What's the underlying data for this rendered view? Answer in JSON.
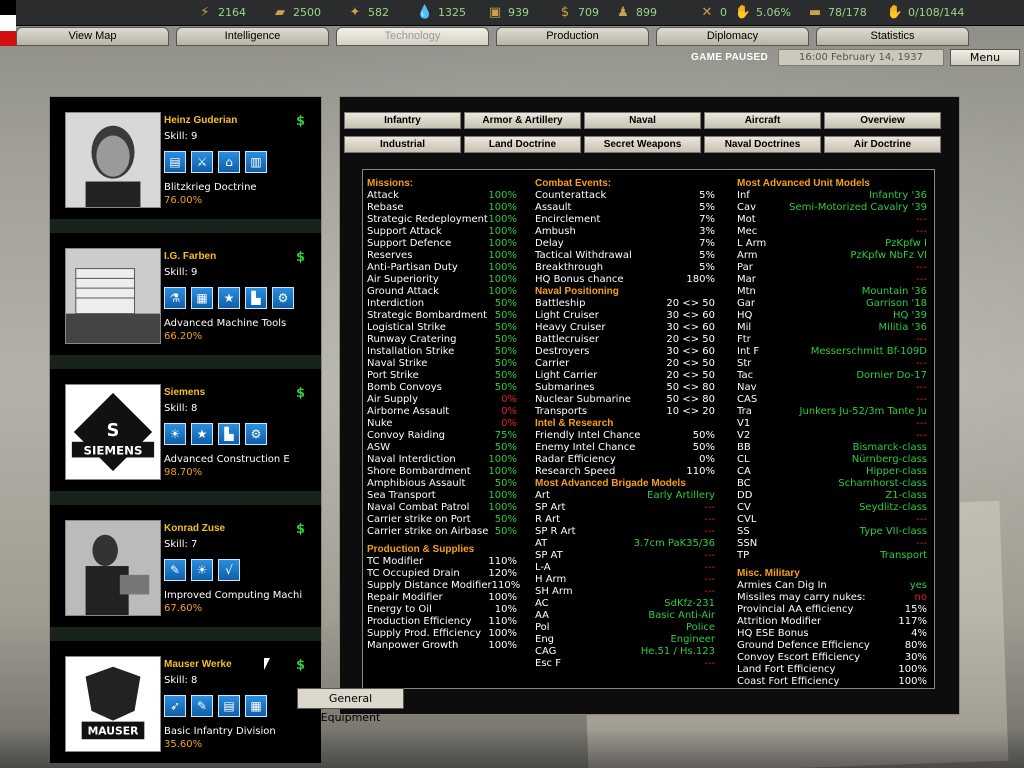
{
  "topbar": {
    "resources": [
      {
        "icon": "energy-icon",
        "value": "2164"
      },
      {
        "icon": "metal-icon",
        "value": "2500"
      },
      {
        "icon": "rare-materials-icon",
        "value": "582"
      },
      {
        "icon": "oil-icon",
        "value": "1325"
      },
      {
        "icon": "supplies-icon",
        "value": "939"
      },
      {
        "icon": "money-icon",
        "value": "709"
      },
      {
        "icon": "manpower-icon",
        "value": "899"
      },
      {
        "icon": "transports-icon",
        "value": "0"
      },
      {
        "icon": "dissent-icon",
        "value": "5.06%"
      },
      {
        "icon": "convoy-icon",
        "value": "78/178"
      },
      {
        "icon": "diplomacy-influence-icon",
        "value": "0/108/144"
      }
    ]
  },
  "tabs": [
    {
      "label": "View Map",
      "active": false
    },
    {
      "label": "Intelligence",
      "active": false
    },
    {
      "label": "Technology",
      "active": true
    },
    {
      "label": "Production",
      "active": false
    },
    {
      "label": "Diplomacy",
      "active": false
    },
    {
      "label": "Statistics",
      "active": false
    }
  ],
  "status": {
    "paused": "GAME PAUSED",
    "date": "16:00 February 14, 1937",
    "menu": "Menu"
  },
  "orgs": [
    {
      "name": "Heinz Guderian",
      "skill": "Skill: 9",
      "dollar": "$",
      "spec": "Blitzkrieg Doctrine",
      "pct": "76.00%",
      "icons": [
        "doctrine-book-icon",
        "blitz-icon",
        "structure-icon",
        "tank-doctrine-icon"
      ]
    },
    {
      "name": "I.G. Farben",
      "skill": "Skill: 9",
      "dollar": "$",
      "spec": "Advanced Machine Tools",
      "pct": "66.20%",
      "icons": [
        "chemistry-flask-icon",
        "equipment-icon",
        "star-icon",
        "industry-icon",
        "gears-icon"
      ]
    },
    {
      "name": "Siemens",
      "skill": "Skill: 8",
      "dollar": "$",
      "spec": "Advanced Construction E",
      "pct": "98.70%",
      "icons": [
        "lightbulb-icon",
        "star-icon",
        "industry-icon",
        "gears-icon"
      ]
    },
    {
      "name": "Konrad Zuse",
      "skill": "Skill: 7",
      "dollar": "$",
      "spec": "Improved Computing Machi",
      "pct": "67.60%",
      "icons": [
        "wrench-icon",
        "lightbulb-icon",
        "math-icon"
      ]
    },
    {
      "name": "Mauser Werke",
      "skill": "Skill: 8",
      "dollar": "$",
      "spec": "Basic Infantry Division",
      "pct": "35.60%",
      "icons": [
        "rifle-icon",
        "wrench-icon",
        "doctrine-book-icon",
        "equipment-icon"
      ]
    }
  ],
  "subtabs_row1": [
    "Infantry",
    "Armor & Artillery",
    "Naval",
    "Aircraft",
    "Overview"
  ],
  "subtabs_row2": [
    "Industrial",
    "Land Doctrine",
    "Secret Weapons",
    "Naval Doctrines",
    "Air Doctrine"
  ],
  "missions": {
    "title": "Missions:",
    "rows": [
      [
        "Attack",
        "100%",
        "g"
      ],
      [
        "Rebase",
        "100%",
        "g"
      ],
      [
        "Strategic Redeployment",
        "100%",
        "g"
      ],
      [
        "Support Attack",
        "100%",
        "g"
      ],
      [
        "Support Defence",
        "100%",
        "g"
      ],
      [
        "Reserves",
        "100%",
        "g"
      ],
      [
        "Anti-Partisan Duty",
        "100%",
        "g"
      ],
      [
        "Air Superiority",
        "100%",
        "g"
      ],
      [
        "Ground Attack",
        "100%",
        "g"
      ],
      [
        "Interdiction",
        "50%",
        "g"
      ],
      [
        "Strategic Bombardment",
        "50%",
        "g"
      ],
      [
        "Logistical Strike",
        "50%",
        "g"
      ],
      [
        "Runway Cratering",
        "50%",
        "g"
      ],
      [
        "Installation Strike",
        "50%",
        "g"
      ],
      [
        "Naval Strike",
        "50%",
        "g"
      ],
      [
        "Port Strike",
        "50%",
        "g"
      ],
      [
        "Bomb Convoys",
        "50%",
        "g"
      ],
      [
        "Air Supply",
        "0%",
        "r"
      ],
      [
        "Airborne Assault",
        "0%",
        "r"
      ],
      [
        "Nuke",
        "0%",
        "r"
      ],
      [
        "Convoy Raiding",
        "75%",
        "g"
      ],
      [
        "ASW",
        "50%",
        "g"
      ],
      [
        "Naval Interdiction",
        "100%",
        "g"
      ],
      [
        "Shore Bombardment",
        "100%",
        "g"
      ],
      [
        "Amphibious Assault",
        "50%",
        "g"
      ],
      [
        "Sea Transport",
        "100%",
        "g"
      ],
      [
        "Naval Combat Patrol",
        "100%",
        "g"
      ],
      [
        "Carrier strike on Port",
        "50%",
        "g"
      ],
      [
        "Carrier strike on Airbase",
        "50%",
        "g"
      ]
    ]
  },
  "production": {
    "title": "Production & Supplies",
    "rows": [
      [
        "TC Modifier",
        "110%",
        "w"
      ],
      [
        "TC Occupied Drain",
        "120%",
        "w"
      ],
      [
        "Supply Distance Modifier",
        "110%",
        "w"
      ],
      [
        "Repair Modifier",
        "100%",
        "w"
      ],
      [
        "Energy to Oil",
        "10%",
        "w"
      ],
      [
        "Production Efficiency",
        "110%",
        "w"
      ],
      [
        "Supply Prod. Efficiency",
        "100%",
        "w"
      ],
      [
        "Manpower Growth",
        "100%",
        "w"
      ]
    ]
  },
  "combat_events": {
    "title": "Combat Events:",
    "rows": [
      [
        "Counterattack",
        "5%",
        "w"
      ],
      [
        "Assault",
        "5%",
        "w"
      ],
      [
        "Encirclement",
        "7%",
        "w"
      ],
      [
        "Ambush",
        "3%",
        "w"
      ],
      [
        "Delay",
        "7%",
        "w"
      ],
      [
        "Tactical Withdrawal",
        "5%",
        "w"
      ],
      [
        "Breakthrough",
        "5%",
        "w"
      ],
      [
        "HQ Bonus chance",
        "180%",
        "w"
      ]
    ]
  },
  "naval_positioning": {
    "title": "Naval Positioning",
    "rows": [
      [
        "Battleship",
        "20 <> 50",
        "w"
      ],
      [
        "Light Cruiser",
        "30 <> 60",
        "w"
      ],
      [
        "Heavy Cruiser",
        "30 <> 60",
        "w"
      ],
      [
        "Battlecruiser",
        "20 <> 50",
        "w"
      ],
      [
        "Destroyers",
        "30 <> 60",
        "w"
      ],
      [
        "Carrier",
        "20 <> 50",
        "w"
      ],
      [
        "Light Carrier",
        "20 <> 50",
        "w"
      ],
      [
        "Submarines",
        "50 <> 80",
        "w"
      ],
      [
        "Nuclear Submarine",
        "50 <> 80",
        "w"
      ],
      [
        "Transports",
        "10 <> 20",
        "w"
      ]
    ]
  },
  "intel": {
    "title": "Intel & Research",
    "rows": [
      [
        "Friendly Intel Chance",
        "50%",
        "w"
      ],
      [
        "Enemy Intel Chance",
        "50%",
        "w"
      ],
      [
        "Radar Efficiency",
        "0%",
        "w"
      ],
      [
        "Research Speed",
        "110%",
        "w"
      ]
    ]
  },
  "brigades": {
    "title": "Most Advanced Brigade Models",
    "rows": [
      [
        "Art",
        "Early Artillery",
        "g"
      ],
      [
        "SP Art",
        "---",
        "r"
      ],
      [
        "R Art",
        "---",
        "r"
      ],
      [
        "SP R Art",
        "---",
        "r"
      ],
      [
        "AT",
        "3.7cm PaK35/36",
        "g"
      ],
      [
        "SP AT",
        "---",
        "r"
      ],
      [
        "L-A",
        "---",
        "r"
      ],
      [
        "H Arm",
        "---",
        "r"
      ],
      [
        "SH Arm",
        "---",
        "r"
      ],
      [
        "AC",
        "SdKfz-231",
        "g"
      ],
      [
        "AA",
        "Basic Anti-Air",
        "g"
      ],
      [
        "Pol",
        "Police",
        "g"
      ],
      [
        "Eng",
        "Engineer",
        "g"
      ],
      [
        "CAG",
        "He.51 / Hs.123",
        "g"
      ],
      [
        "Esc F",
        "---",
        "r"
      ]
    ]
  },
  "units": {
    "title": "Most Advanced Unit Models",
    "rows": [
      [
        "Inf",
        "Infantry '36",
        "g"
      ],
      [
        "Cav",
        "Semi-Motorized Cavalry '39",
        "g"
      ],
      [
        "Mot",
        "---",
        "r"
      ],
      [
        "Mec",
        "---",
        "r"
      ],
      [
        "L Arm",
        "PzKpfw I",
        "g"
      ],
      [
        "Arm",
        "PzKpfw NbFz VI",
        "g"
      ],
      [
        "Par",
        "---",
        "r"
      ],
      [
        "Mar",
        "---",
        "r"
      ],
      [
        "Mtn",
        "Mountain '36",
        "g"
      ],
      [
        "Gar",
        "Garrison '18",
        "g"
      ],
      [
        "HQ",
        "HQ '39",
        "g"
      ],
      [
        "Mil",
        "Militia '36",
        "g"
      ],
      [
        "Ftr",
        "---",
        "r"
      ],
      [
        "Int F",
        "Messerschmitt Bf-109D",
        "g"
      ],
      [
        "Str",
        "---",
        "r"
      ],
      [
        "Tac",
        "Dornier Do-17",
        "g"
      ],
      [
        "Nav",
        "---",
        "r"
      ],
      [
        "CAS",
        "---",
        "r"
      ],
      [
        "Tra",
        "Junkers Ju-52/3m Tante Ju",
        "g"
      ],
      [
        "V1",
        "---",
        "r"
      ],
      [
        "V2",
        "---",
        "r"
      ],
      [
        "BB",
        "Bismarck-class",
        "g"
      ],
      [
        "CL",
        "Nürnberg-class",
        "g"
      ],
      [
        "CA",
        "Hipper-class",
        "g"
      ],
      [
        "BC",
        "Scharnhorst-class",
        "g"
      ],
      [
        "DD",
        "Z1-class",
        "g"
      ],
      [
        "CV",
        "Seydlitz-class",
        "g"
      ],
      [
        "CVL",
        "---",
        "r"
      ],
      [
        "SS",
        "Type VII-class",
        "g"
      ],
      [
        "SSN",
        "---",
        "r"
      ],
      [
        "TP",
        "Transport",
        "g"
      ]
    ]
  },
  "misc": {
    "title": "Misc. Military",
    "rows": [
      [
        "Armies Can Dig In",
        "yes",
        "g"
      ],
      [
        "Missiles may carry nukes:",
        "no",
        "r"
      ],
      [
        "Provincial AA efficiency",
        "15%",
        "w"
      ],
      [
        "Attrition Modifier",
        "117%",
        "w"
      ],
      [
        "HQ ESE Bonus",
        "4%",
        "w"
      ],
      [
        "Ground Defence Efficiency",
        "80%",
        "w"
      ],
      [
        "Convoy Escort Efficiency",
        "30%",
        "w"
      ],
      [
        "Land Fort Efficiency",
        "100%",
        "w"
      ],
      [
        "Coast Fort Efficiency",
        "100%",
        "w"
      ]
    ]
  },
  "tooltip": "General Equipment"
}
